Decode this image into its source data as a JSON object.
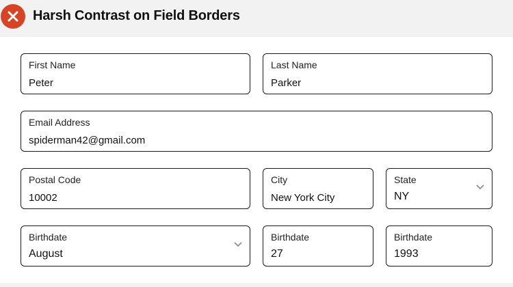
{
  "header": {
    "title": "Harsh Contrast on Field Borders",
    "status_icon": "error-x-icon",
    "accent": "#d64325"
  },
  "form": {
    "first_name": {
      "label": "First Name",
      "value": "Peter"
    },
    "last_name": {
      "label": "Last Name",
      "value": "Parker"
    },
    "email": {
      "label": "Email Address",
      "value": "spiderman42@gmail.com"
    },
    "postal_code": {
      "label": "Postal Code",
      "value": "10002"
    },
    "city": {
      "label": "City",
      "value": "New York City"
    },
    "state": {
      "label": "State",
      "value": "NY"
    },
    "birth_month": {
      "label": "Birthdate",
      "value": "August"
    },
    "birth_day": {
      "label": "Birthdate",
      "value": "27"
    },
    "birth_year": {
      "label": "Birthdate",
      "value": "1993"
    }
  },
  "colors": {
    "border": "#1a1a1a",
    "background": "#f2f2f3",
    "panel": "#ffffff"
  }
}
